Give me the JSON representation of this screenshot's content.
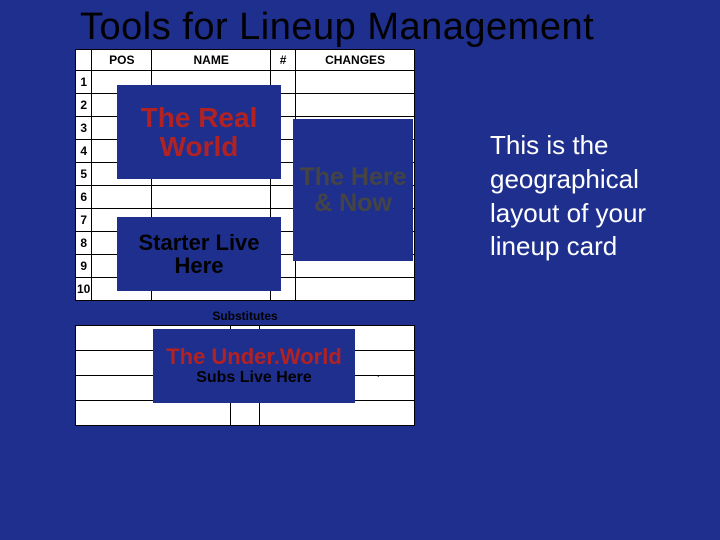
{
  "title": "Tools for Lineup Management",
  "table": {
    "headers": {
      "pos": "POS",
      "name": "NAME",
      "num": "#",
      "changes": "CHANGES"
    },
    "rows": [
      "1",
      "2",
      "3",
      "4",
      "5",
      "6",
      "7",
      "8",
      "9",
      "10"
    ]
  },
  "subs_label": "Substitutes",
  "annotations": {
    "real": "The Real World",
    "starter": "Starter Live Here",
    "here": "The Here & Now",
    "under": "The Under.World",
    "subs_live": "Subs Live Here"
  },
  "caption": "This is the geographical layout of your lineup card"
}
